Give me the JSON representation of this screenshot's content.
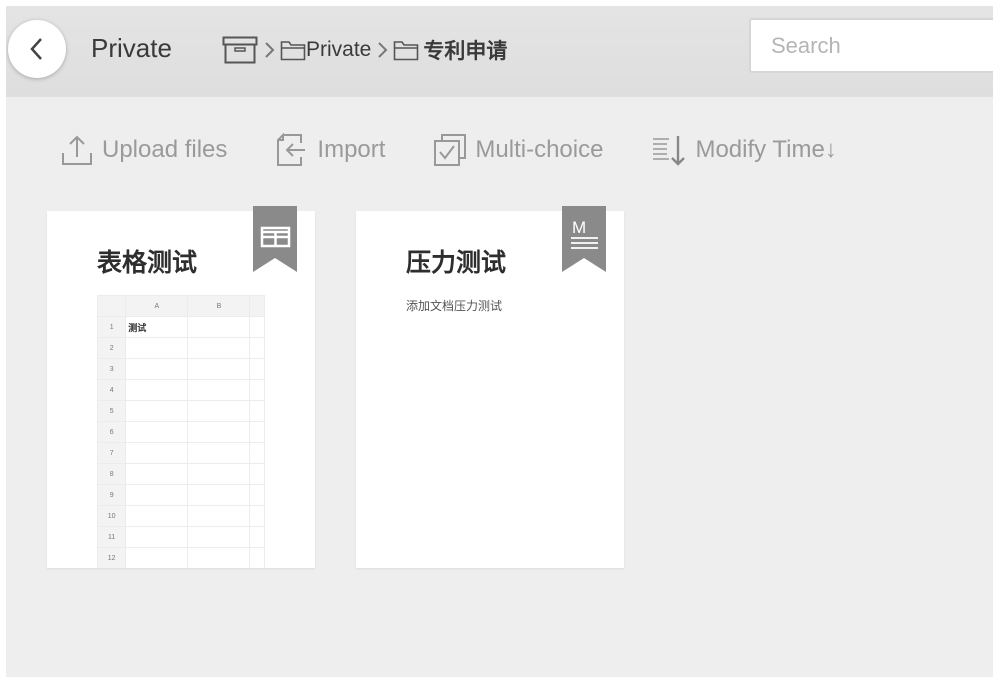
{
  "header": {
    "back_label": "Back",
    "title": "Private",
    "breadcrumb": [
      {
        "icon": "archive-box-icon",
        "label": ""
      },
      {
        "icon": "folder-icon",
        "label": "Private"
      },
      {
        "icon": "folder-icon",
        "label": "专利申请"
      }
    ],
    "search": {
      "placeholder": "Search",
      "value": ""
    }
  },
  "toolbar": {
    "upload": {
      "label": "Upload files",
      "icon": "upload-icon"
    },
    "import": {
      "label": "Import",
      "icon": "import-icon"
    },
    "multi_choice": {
      "label": "Multi-choice",
      "icon": "multi-choice-icon"
    },
    "sort": {
      "label": "Modify Time↓",
      "icon": "sort-descending-icon"
    }
  },
  "files": [
    {
      "title": "表格测试",
      "type": "spreadsheet",
      "badge_icon": "table-icon",
      "preview": {
        "columns": [
          "A",
          "B"
        ],
        "rows": [
          {
            "num": "1",
            "A": "测试",
            "B": ""
          },
          {
            "num": "2",
            "A": "",
            "B": ""
          },
          {
            "num": "3",
            "A": "",
            "B": ""
          },
          {
            "num": "4",
            "A": "",
            "B": ""
          },
          {
            "num": "5",
            "A": "",
            "B": ""
          },
          {
            "num": "6",
            "A": "",
            "B": ""
          },
          {
            "num": "7",
            "A": "",
            "B": ""
          },
          {
            "num": "8",
            "A": "",
            "B": ""
          },
          {
            "num": "9",
            "A": "",
            "B": ""
          },
          {
            "num": "10",
            "A": "",
            "B": ""
          },
          {
            "num": "11",
            "A": "",
            "B": ""
          },
          {
            "num": "12",
            "A": "",
            "B": ""
          }
        ]
      }
    },
    {
      "title": "压力测试",
      "type": "markdown",
      "badge_icon": "markdown-icon",
      "badge_letter": "M",
      "description": "添加文档压力测试"
    }
  ]
}
